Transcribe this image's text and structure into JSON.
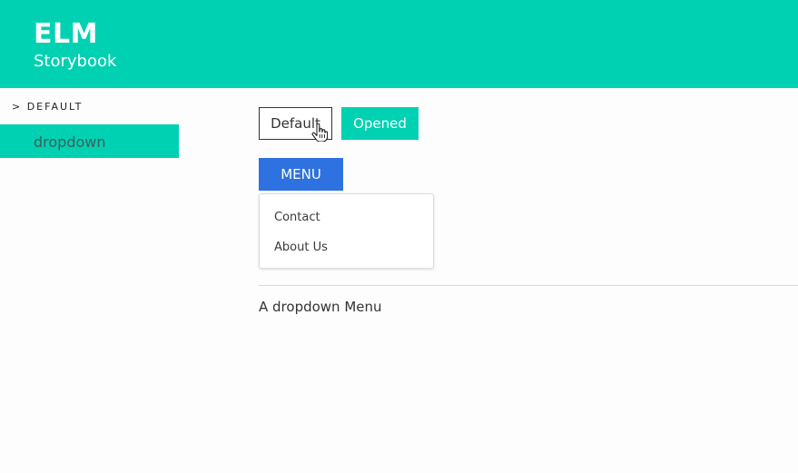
{
  "header": {
    "title": "ELM",
    "subtitle": "Storybook"
  },
  "sidebar": {
    "section_title": "> DEFAULT",
    "items": [
      {
        "label": "dropdown",
        "active": true
      }
    ]
  },
  "main": {
    "buttons": {
      "default_label": "Default",
      "opened_label": "Opened"
    },
    "menu": {
      "button_label": "MENU",
      "options": [
        "Contact",
        "About Us"
      ]
    },
    "description": "A dropdown Menu"
  },
  "colors": {
    "accent": "#00d1b2",
    "menu_button": "#2e71e0"
  },
  "icons": [
    "hand-pointer-cursor-icon"
  ]
}
